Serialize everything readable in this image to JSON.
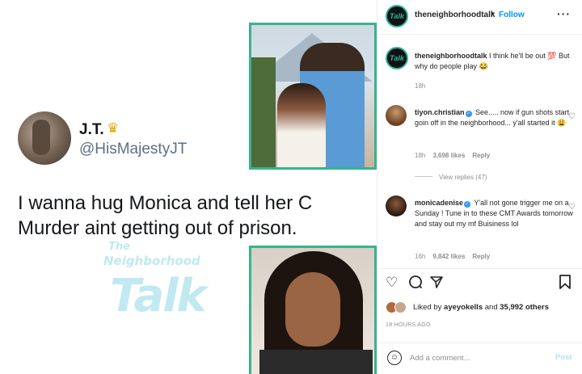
{
  "tweet": {
    "name": "J.T.",
    "handle": "@HisMajestyJT",
    "text": "I wanna hug Monica and tell her C Murder aint getting out of prison."
  },
  "watermark": {
    "line1": "The",
    "line2": "Neighborhood",
    "line3": "Talk"
  },
  "post_header": {
    "username": "theneighborhoodtalk",
    "dot": "•",
    "follow_label": "Follow",
    "more_label": "···",
    "avatar_text": "Talk"
  },
  "caption": {
    "username": "theneighborhoodtalk",
    "text": "I think he'll be out 💯 But why do people play 😂",
    "time": "18h"
  },
  "comments": [
    {
      "username": "tiyon.christian",
      "text": "See..... now if gun shots start goin off in the neighborhood... y'all started it 😩",
      "time": "18h",
      "likes": "3,698 likes",
      "reply": "Reply"
    },
    {
      "username": "monicadenise",
      "text": "Y'all not gone trigger me on a Sunday ! Tune in to these CMT Awards tomorrow and stay out my mf Buisiness lol",
      "time": "16h",
      "likes": "9,842 likes",
      "reply": "Reply"
    }
  ],
  "view_replies": "View replies (47)",
  "likes_summary": {
    "prefix": "Liked by",
    "user": "ayeyokells",
    "middle": "and",
    "count": "35,992 others"
  },
  "time_ago": "18 HOURS AGO",
  "add_comment": {
    "placeholder": "Add a comment...",
    "post_label": "Post"
  },
  "icons": {
    "heart": "heart-icon",
    "comment": "comment-icon",
    "share": "share-icon",
    "save": "bookmark-icon",
    "emoji": "emoji-icon",
    "verified": "verified-icon"
  },
  "colors": {
    "follow_blue": "#0095f6",
    "post_disabled": "#b2dffc",
    "frame_green": "#38b48b",
    "watermark": "#b6e6f0",
    "verified": "#3897f0"
  }
}
